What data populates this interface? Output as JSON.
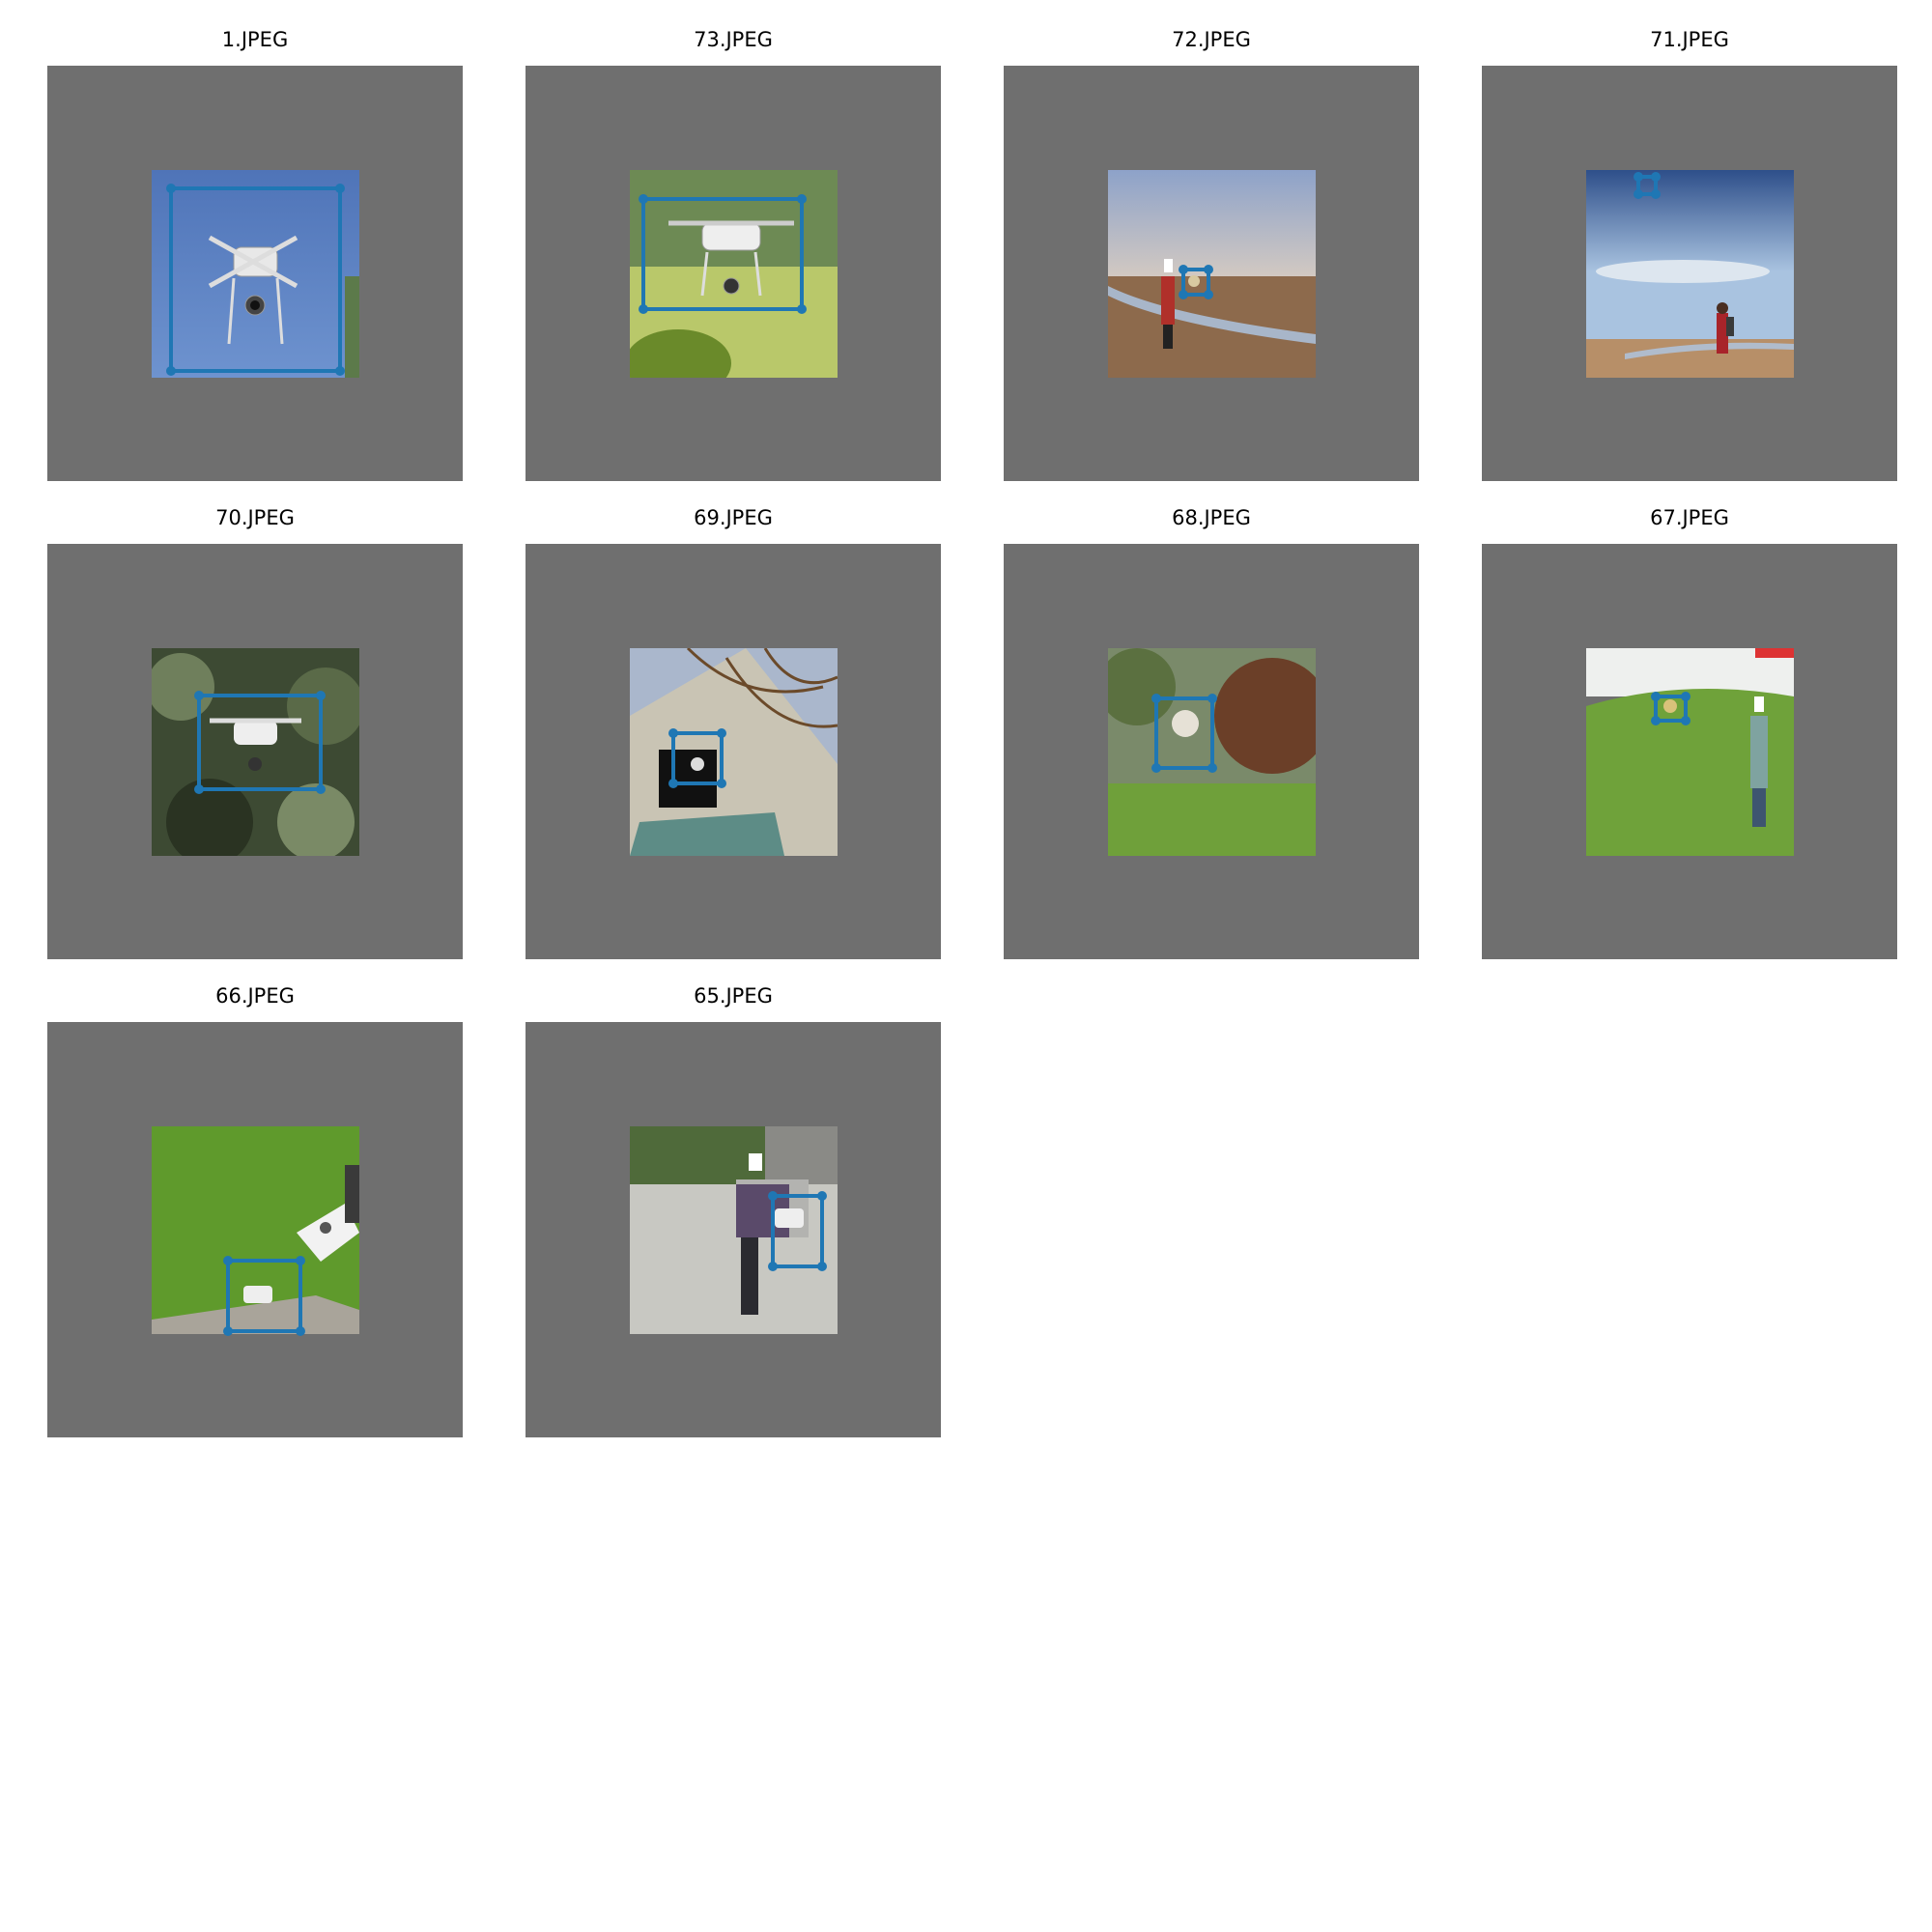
{
  "colors": {
    "padding": "#6f6f6f",
    "box": "#1f77b4",
    "background": "#ffffff"
  },
  "tiles": [
    {
      "title": "1.JPEG",
      "scene": "drone against blue sky"
    },
    {
      "title": "73.JPEG",
      "scene": "drone hovering over lawn"
    },
    {
      "title": "72.JPEG",
      "scene": "person with drone at shoreline"
    },
    {
      "title": "71.JPEG",
      "scene": "drone high in sky above shoreline"
    },
    {
      "title": "70.JPEG",
      "scene": "drone with blurred foliage"
    },
    {
      "title": "69.JPEG",
      "scene": "drone near old building and tree"
    },
    {
      "title": "68.JPEG",
      "scene": "drone by autumn tree"
    },
    {
      "title": "67.JPEG",
      "scene": "person flying drone over field"
    },
    {
      "title": "66.JPEG",
      "scene": "drone on grass with remote controller"
    },
    {
      "title": "65.JPEG",
      "scene": "person holding drone in courtyard"
    }
  ]
}
